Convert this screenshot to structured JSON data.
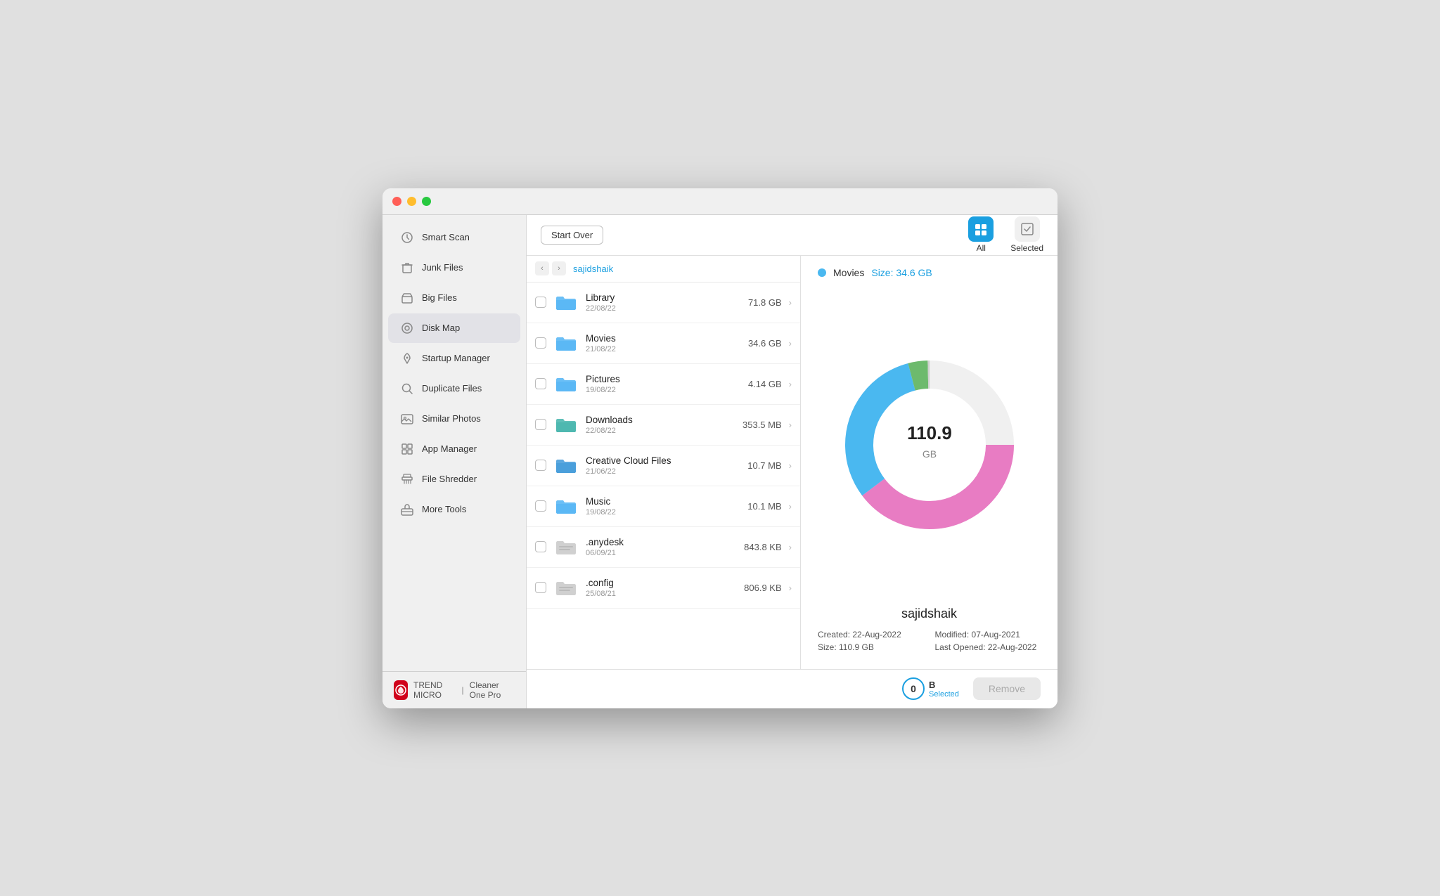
{
  "window": {
    "title": "Cleaner One Pro"
  },
  "titlebar": {
    "close": "close",
    "minimize": "minimize",
    "maximize": "maximize"
  },
  "sidebar": {
    "items": [
      {
        "id": "smart-scan",
        "label": "Smart Scan",
        "icon": "clock"
      },
      {
        "id": "junk-files",
        "label": "Junk Files",
        "icon": "trash"
      },
      {
        "id": "big-files",
        "label": "Big Files",
        "icon": "box"
      },
      {
        "id": "disk-map",
        "label": "Disk Map",
        "icon": "disk",
        "active": true
      },
      {
        "id": "startup-manager",
        "label": "Startup Manager",
        "icon": "rocket"
      },
      {
        "id": "duplicate-files",
        "label": "Duplicate Files",
        "icon": "search"
      },
      {
        "id": "similar-photos",
        "label": "Similar Photos",
        "icon": "photo"
      },
      {
        "id": "app-manager",
        "label": "App Manager",
        "icon": "grid"
      },
      {
        "id": "file-shredder",
        "label": "File Shredder",
        "icon": "shredder"
      },
      {
        "id": "more-tools",
        "label": "More Tools",
        "icon": "toolbox"
      }
    ],
    "footer": {
      "brand": "TREND MICRO",
      "app_name": "Cleaner One Pro"
    }
  },
  "topbar": {
    "start_over_label": "Start Over",
    "tabs": [
      {
        "id": "all",
        "label": "All",
        "active": true
      },
      {
        "id": "selected",
        "label": "Selected",
        "active": false
      }
    ]
  },
  "breadcrumb": {
    "folder": "sajidshaik"
  },
  "file_list": [
    {
      "name": "Library",
      "date": "22/08/22",
      "size": "71.8 GB",
      "color": "blue"
    },
    {
      "name": "Movies",
      "date": "21/08/22",
      "size": "34.6 GB",
      "color": "blue"
    },
    {
      "name": "Pictures",
      "date": "19/08/22",
      "size": "4.14 GB",
      "color": "blue"
    },
    {
      "name": "Downloads",
      "date": "22/08/22",
      "size": "353.5 MB",
      "color": "blue-teal"
    },
    {
      "name": "Creative Cloud Files",
      "date": "21/06/22",
      "size": "10.7 MB",
      "color": "blue-dark"
    },
    {
      "name": "Music",
      "date": "19/08/22",
      "size": "10.1 MB",
      "color": "blue"
    },
    {
      "name": ".anydesk",
      "date": "06/09/21",
      "size": "843.8 KB",
      "color": "gray"
    },
    {
      "name": ".config",
      "date": "25/08/21",
      "size": "806.9 KB",
      "color": "gray"
    }
  ],
  "detail": {
    "legend": {
      "color": "#4ab8f0",
      "name": "Movies",
      "size_label": "Size: 34.6 GB"
    },
    "donut": {
      "total_label": "110.9",
      "total_unit": "GB"
    },
    "folder_name": "sajidshaik",
    "meta": {
      "created": "Created: 22-Aug-2022",
      "modified": "Modified: 07-Aug-2021",
      "size": "Size: 110.9 GB",
      "last_opened": "Last Opened: 22-Aug-2022"
    }
  },
  "bottom_bar": {
    "selected_size": "0",
    "selected_unit": "B",
    "selected_label": "Selected",
    "remove_label": "Remove"
  }
}
